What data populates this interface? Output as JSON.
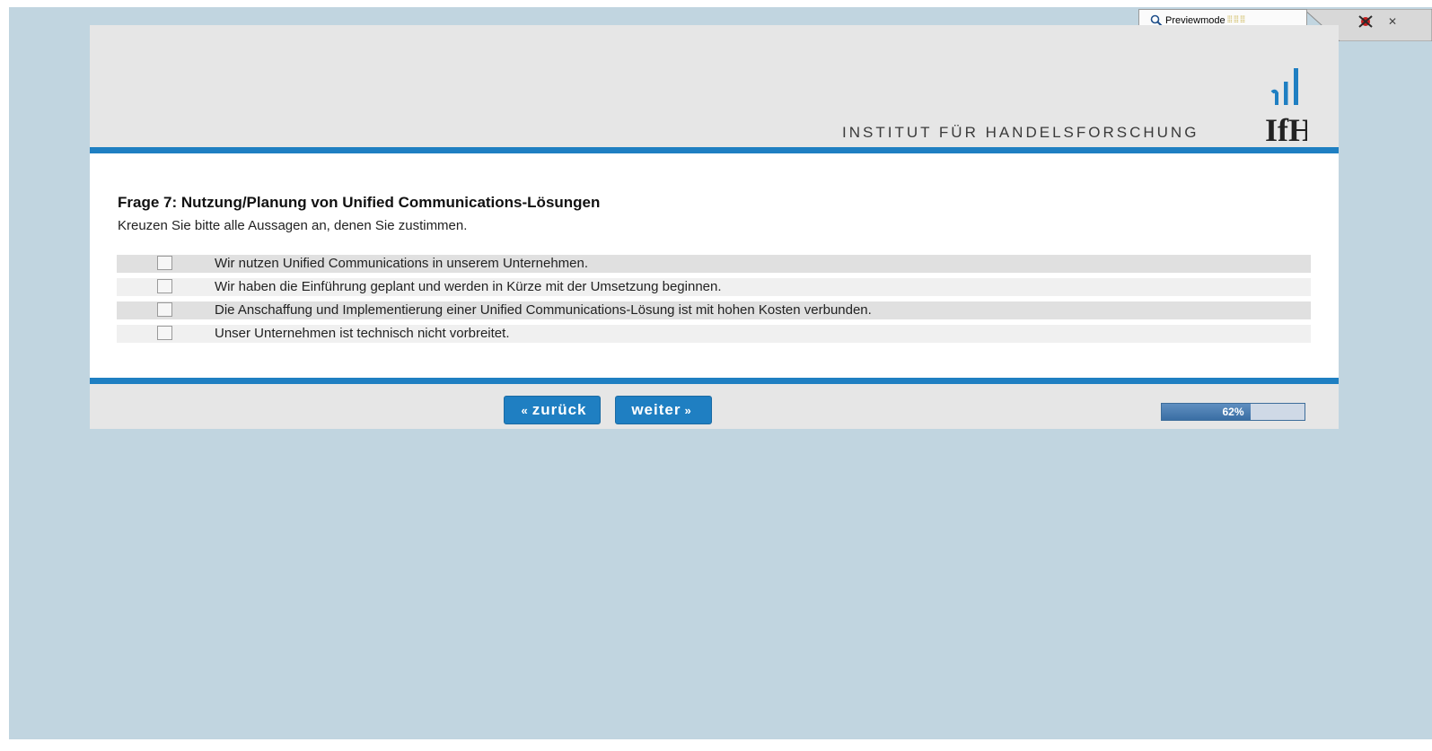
{
  "toolbar": {
    "preview_label": "Previewmode",
    "close_label": "✕"
  },
  "header": {
    "institute_name": "INSTITUT FÜR HANDELSFORSCHUNG",
    "logo_text": "IfH"
  },
  "question": {
    "title": "Frage 7: Nutzung/Planung von Unified Communications-Lösungen",
    "instruction": "Kreuzen Sie bitte alle Aussagen an, denen Sie zustimmen.",
    "options": [
      {
        "label": "Wir nutzen Unified Communications in unserem Unternehmen.",
        "checked": false
      },
      {
        "label": "Wir haben die Einführung geplant und werden in Kürze mit der Umsetzung beginnen.",
        "checked": false
      },
      {
        "label": "Die Anschaffung und Implementierung einer Unified Communications-Lösung ist mit hohen Kosten verbunden.",
        "checked": false
      },
      {
        "label": "Unser Unternehmen ist technisch nicht vorbreitet.",
        "checked": false
      }
    ]
  },
  "footer": {
    "back_label": "zurück",
    "next_label": "weiter",
    "progress_percent": 62,
    "progress_text": "62%"
  },
  "colors": {
    "accent": "#1f7fc2",
    "background": "#c1d5e0",
    "header_bg": "#e6e6e6"
  }
}
